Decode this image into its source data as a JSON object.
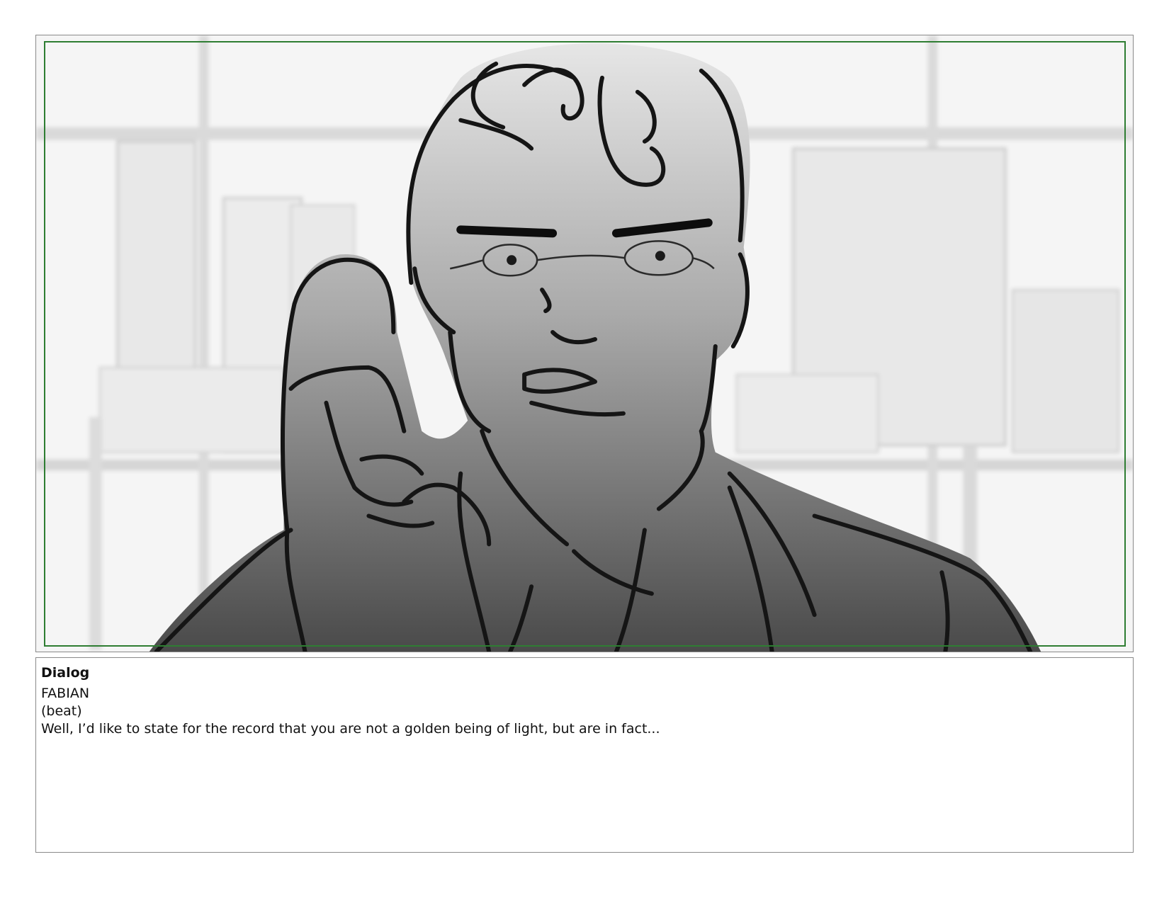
{
  "dialog": {
    "heading": "Dialog",
    "character": "FABIAN",
    "parenthetical": "(beat)",
    "line": "Well, I’d like to state for the record that you are not a golden being of light, but are in fact..."
  },
  "colors": {
    "safe_area_border": "#2e7d32",
    "frame_border": "#8a8a8a"
  }
}
